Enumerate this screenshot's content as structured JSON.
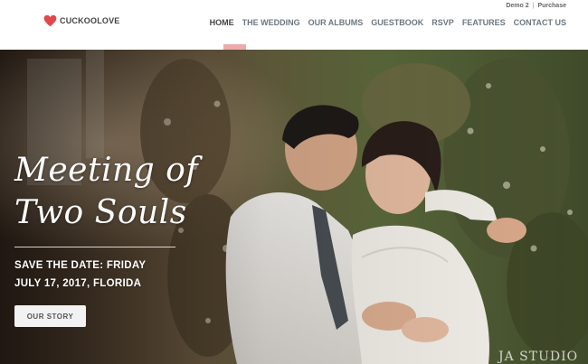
{
  "header": {
    "logo_text": "CUCKOOLOVE",
    "top_links": [
      "Demo 2",
      "Purchase"
    ],
    "top_links_separator": "|",
    "nav": [
      "HOME",
      "THE WEDDING",
      "OUR ALBUMS",
      "GUESTBOOK",
      "RSVP",
      "FEATURES",
      "CONTACT US"
    ],
    "active_nav": "HOME"
  },
  "hero": {
    "title_line1": "Meeting of",
    "title_line2": "Two Souls",
    "date_line1": "SAVE THE DATE: FRIDAY",
    "date_line2": "JULY 17, 2017, FLORIDA",
    "button_label": "OUR STORY",
    "watermark": "JA STUDIO"
  },
  "colors": {
    "accent": "#eeaaab",
    "heart": "#e0484c",
    "nav_text": "#6b7780",
    "button_bg": "#f2f2f2"
  },
  "icons": {
    "logo": "heart-icon"
  }
}
